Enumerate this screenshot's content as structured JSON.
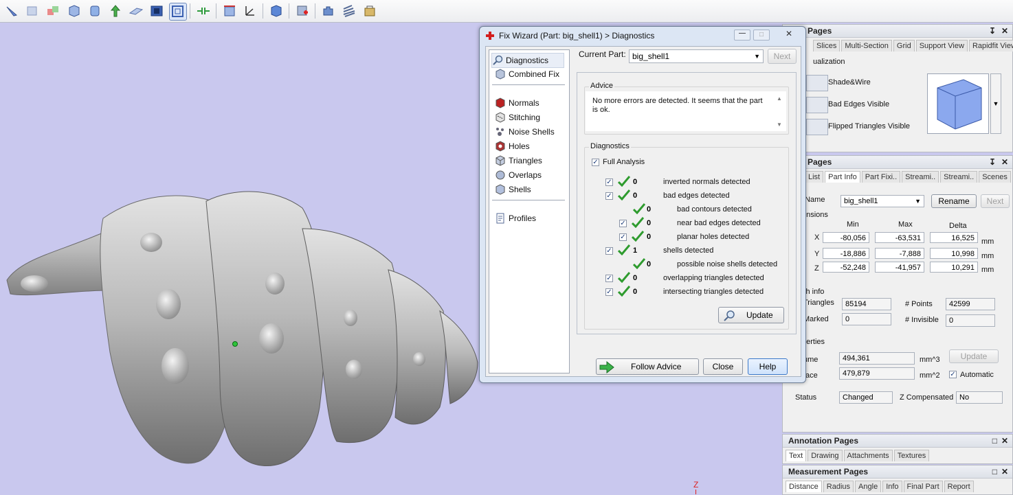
{
  "dialog": {
    "title": "Fix Wizard (Part: big_shell1) > Diagnostics",
    "nav": {
      "diagnostics": "Diagnostics",
      "combined_fix": "Combined Fix",
      "normals": "Normals",
      "stitching": "Stitching",
      "noise_shells": "Noise Shells",
      "holes": "Holes",
      "triangles": "Triangles",
      "overlaps": "Overlaps",
      "shells": "Shells",
      "profiles": "Profiles"
    },
    "current_part_label": "Current Part:",
    "current_part_value": "big_shell1",
    "next_label": "Next",
    "advice_title": "Advice",
    "advice_text": "No more errors are detected. It seems that the part is ok.",
    "diagnostics_title": "Diagnostics",
    "full_analysis_label": "Full Analysis",
    "rows": [
      {
        "count": "0",
        "text": "inverted normals detected"
      },
      {
        "count": "0",
        "text": "bad edges detected"
      },
      {
        "count": "0",
        "text": "bad contours detected"
      },
      {
        "count": "0",
        "text": "near bad edges detected"
      },
      {
        "count": "0",
        "text": "planar holes detected"
      },
      {
        "count": "1",
        "text": "shells detected"
      },
      {
        "count": "0",
        "text": "possible noise shells detected"
      },
      {
        "count": "0",
        "text": "overlapping triangles detected"
      },
      {
        "count": "0",
        "text": "intersecting triangles detected"
      }
    ],
    "update_label": "Update",
    "follow_advice_label": "Follow Advice",
    "close_label": "Close",
    "help_label": "Help"
  },
  "view_pages": {
    "title": "Pages",
    "tabs": [
      "Slices",
      "Multi-Section",
      "Grid",
      "Support View",
      "Rapidfit View"
    ],
    "visualization_label": "ualization",
    "options": [
      "Shade&Wire",
      "Bad Edges Visible",
      "Flipped Triangles Visible"
    ]
  },
  "part_pages": {
    "title": "Pages",
    "tabs": [
      "List",
      "Part Info",
      "Part Fixi..",
      "Streami..",
      "Streami..",
      "Scenes"
    ],
    "name_label": "t Name",
    "name_value": "big_shell1",
    "rename_label": "Rename",
    "next_label": "Next",
    "dimensions_label": "ensions",
    "col_min": "Min",
    "col_max": "Max",
    "col_delta": "Delta",
    "dims": [
      {
        "axis": "X",
        "min": "-80,056",
        "max": "-63,531",
        "delta": "16,525",
        "unit": "mm"
      },
      {
        "axis": "Y",
        "min": "-18,886",
        "max": "-7,888",
        "delta": "10,998",
        "unit": "mm"
      },
      {
        "axis": "Z",
        "min": "-52,248",
        "max": "-41,957",
        "delta": "10,291",
        "unit": "mm"
      }
    ],
    "mesh_info_label": "sh info",
    "triangles_label": "Triangles",
    "triangles_value": "85194",
    "points_label": "# Points",
    "points_value": "42599",
    "marked_label": "Marked",
    "marked_value": "0",
    "invisible_label": "# Invisible",
    "invisible_value": "0",
    "properties_label": "perties",
    "volume_label": "ume",
    "volume_value": "494,361",
    "volume_unit": "mm^3",
    "surface_label": "face",
    "surface_value": "479,879",
    "surface_unit": "mm^2",
    "update_label": "Update",
    "automatic_label": "Automatic",
    "status_label": "Status",
    "status_value": "Changed",
    "zcomp_label": "Z Compensated",
    "zcomp_value": "No"
  },
  "annotation_pages": {
    "title": "Annotation Pages",
    "tabs": [
      "Text",
      "Drawing",
      "Attachments",
      "Textures"
    ]
  },
  "measurement_pages": {
    "title": "Measurement Pages",
    "tabs": [
      "Distance",
      "Radius",
      "Angle",
      "Info",
      "Final Part",
      "Report"
    ]
  },
  "axis_label": "Z"
}
